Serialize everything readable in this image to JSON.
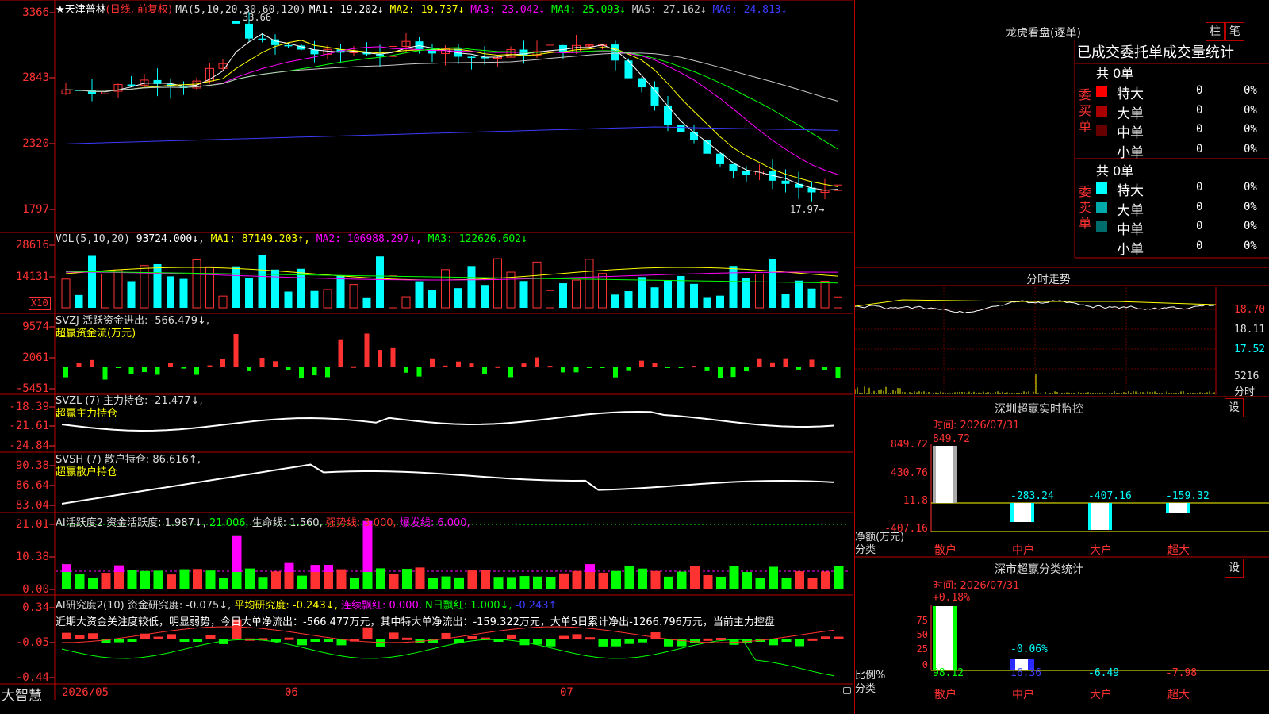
{
  "chart_header": {
    "marker": "★",
    "stock_name": "天津普林",
    "mode": "(日线, 前复权)",
    "ma_title": "MA(5,10,20,30,60,120)",
    "ma_values": [
      {
        "label": "MA1: 19.202↓",
        "color": "#ffffff"
      },
      {
        "label": "MA2: 19.737↓",
        "color": "#ffff00"
      },
      {
        "label": "MA3: 23.042↓",
        "color": "#ff00ff"
      },
      {
        "label": "MA4: 25.093↓",
        "color": "#00ff00"
      },
      {
        "label": "MA5: 27.162↓",
        "color": "#c8c8c8"
      },
      {
        "label": "MA6: 24.813↓",
        "color": "#3c3cff"
      }
    ],
    "high_label": "33.66",
    "low_label": "17.97"
  },
  "price_axis": [
    "3366",
    "2843",
    "2320",
    "1797"
  ],
  "vol_panel": {
    "title": "VOL(5,10,20)",
    "value": "93724.000↓,",
    "ma1": "MA1: 87149.203↑,",
    "ma2": "MA2: 106988.297↓,",
    "ma3": "MA3: 122626.602↓",
    "axis": [
      "28616",
      "14131"
    ],
    "unit": "X10"
  },
  "svzj_panel": {
    "title": "SVZJ  活跃资金进出: -566.479↓,",
    "subtitle": "超赢资金流(万元)",
    "axis": [
      "9574",
      "2061",
      "-5451"
    ]
  },
  "svzl_panel": {
    "title": "SVZL (7) 主力持仓: -21.477↓,",
    "subtitle": "超赢主力持仓",
    "axis": [
      "-18.39",
      "-21.61",
      "-24.84"
    ]
  },
  "svsh_panel": {
    "title": "SVSH (7) 散户持仓: 86.616↑,",
    "subtitle": "超赢散户持仓",
    "axis": [
      "90.38",
      "86.64",
      "83.04"
    ]
  },
  "ai_active_panel": {
    "title": "AI活跃度2 资金活跃度: 1.987↓,",
    "v1": "21.006,",
    "v2": "生命线: 1.560,",
    "v3": "强势线: 3.000,",
    "v4": "爆发线: 6.000,",
    "axis": [
      "21.01",
      "10.38",
      "0.00"
    ]
  },
  "ai_research_panel": {
    "title": "AI研究度2(10) 资金研究度: -0.075↓,",
    "v1": "平均研究度: -0.243↓,",
    "v2": "连续飘红: 0.000,",
    "v3": "N日飘红: 1.000↓,",
    "v4": "-0.243↑",
    "note": "近期大资金关注度较低，明显弱势，今日大单净流出：-566.477万元，其中特大单净流出：-159.322万元，大单5日累计净出-1266.796万元，当前主力控盘",
    "axis": [
      "0.34",
      "-0.05",
      "-0.44"
    ]
  },
  "date_axis": {
    "brand": "大智慧",
    "labels": [
      "2026/05",
      "06",
      "07"
    ]
  },
  "right_panel": {
    "tabs": [
      "柱",
      "笔"
    ],
    "lhb_title": "龙虎看盘(逐单)",
    "lhb_tabs_text": "已成交委托单成交量统计",
    "buy_group": {
      "side_label": "委买单",
      "total": "共 0单",
      "rows": [
        {
          "name": "特大",
          "count": "0",
          "pct": "0%",
          "color": "#ff0000"
        },
        {
          "name": "大单",
          "count": "0",
          "pct": "0%",
          "color": "#aa0000"
        },
        {
          "name": "中单",
          "count": "0",
          "pct": "0%",
          "color": "#660000"
        },
        {
          "name": "小单",
          "count": "0",
          "pct": "0%",
          "color": ""
        }
      ]
    },
    "sell_group": {
      "side_label": "委卖单",
      "total": "共 0单",
      "rows": [
        {
          "name": "特大",
          "count": "0",
          "pct": "0%",
          "color": "#00ffff"
        },
        {
          "name": "大单",
          "count": "0",
          "pct": "0%",
          "color": "#00aaaa"
        },
        {
          "name": "中单",
          "count": "0",
          "pct": "0%",
          "color": "#006c6c"
        },
        {
          "name": "小单",
          "count": "0",
          "pct": "0%",
          "color": ""
        }
      ]
    },
    "intraday_title": "分时走势",
    "intraday_axis": [
      "18.70",
      "18.11",
      "17.52"
    ],
    "intraday_vol": "5216",
    "intraday_vol_label": "分时",
    "monitor_title": "深圳超赢实时监控",
    "monitor_settings": "设",
    "monitor_time": "时间: 2026/07/31",
    "monitor_axis": [
      "849.72",
      "430.76",
      "11.8",
      "-407.16"
    ],
    "monitor_ylabel": "净额(万元)",
    "monitor_xlabel": "分类",
    "monitor_categories": [
      "散户",
      "中户",
      "大户",
      "超大"
    ],
    "monitor_values": [
      "849.72",
      "-283.24",
      "-407.16",
      "-159.32"
    ],
    "class_title": "深市超赢分类统计",
    "class_settings": "设",
    "class_time": "时间: 2026/07/31",
    "class_top_label": "+0.18%",
    "class_mid_label": "-0.06%",
    "class_axis": [
      "75",
      "50",
      "25",
      "0"
    ],
    "class_ylabel": "比例%",
    "class_xlabel": "分类",
    "class_categories": [
      "散户",
      "中户",
      "大户",
      "超大"
    ],
    "class_values": [
      "98.12",
      "16.36",
      "-6.49",
      "-7.98"
    ]
  }
}
